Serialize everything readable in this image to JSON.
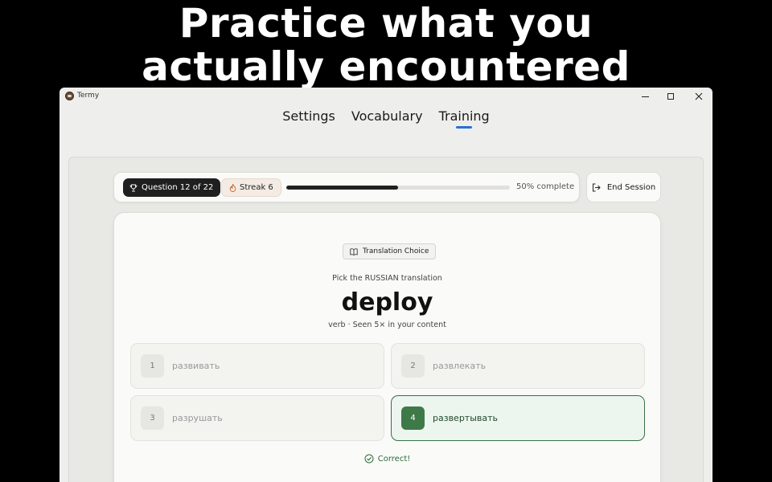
{
  "headline": {
    "line1": "Practice what you",
    "line2": "actually encountered"
  },
  "window": {
    "app_name": "Termy"
  },
  "nav": {
    "tabs": [
      {
        "label": "Settings"
      },
      {
        "label": "Vocabulary"
      },
      {
        "label": "Training",
        "active": true
      }
    ]
  },
  "session": {
    "question_label": "Question 12 of 22",
    "streak_label": "Streak 6",
    "progress_percent": 50,
    "progress_text": "50% complete",
    "end_label": "End Session"
  },
  "card": {
    "type_label": "Translation Choice",
    "prompt": "Pick the RUSSIAN translation",
    "word": "deploy",
    "meta": "verb · Seen 5× in your content",
    "options": [
      {
        "num": "1",
        "label": "развивать"
      },
      {
        "num": "2",
        "label": "развлекать"
      },
      {
        "num": "3",
        "label": "разрушать"
      },
      {
        "num": "4",
        "label": "развертывать",
        "selected": true,
        "correct": true
      }
    ],
    "feedback": "Correct!"
  },
  "colors": {
    "accent": "#2b6fd6",
    "correct_green": "#3d7a47",
    "dark": "#1f1f1f"
  },
  "icons": {
    "app": "sloth-icon",
    "question": "trophy-icon",
    "streak": "flame-icon",
    "end": "exit-icon",
    "type": "book-icon",
    "feedback": "check-circle-icon"
  }
}
